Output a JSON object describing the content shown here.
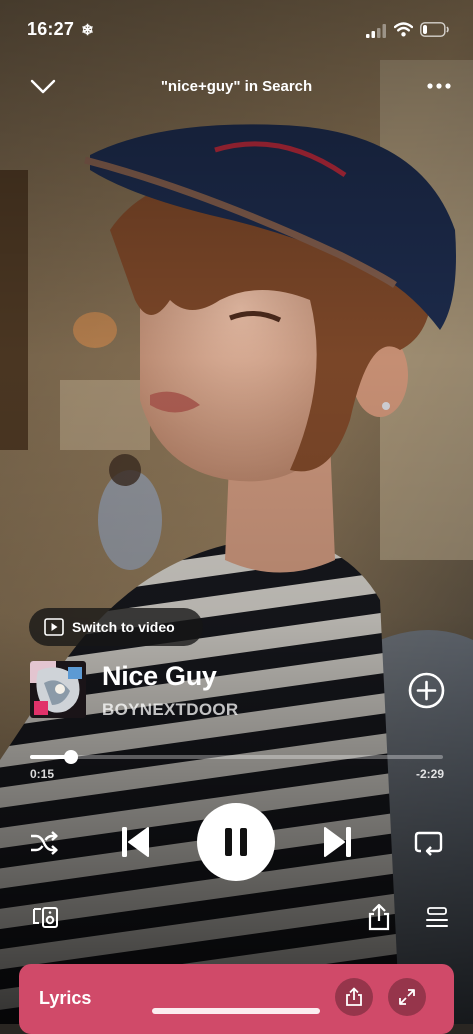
{
  "status_bar": {
    "time": "16:27",
    "snowflake": "❄",
    "icons": [
      "snowflake-icon",
      "cellular-signal-icon",
      "wifi-icon",
      "battery-icon"
    ],
    "battery_level": 0.2
  },
  "header": {
    "title": "\"nice+guy\" in Search",
    "icons": [
      "chevron-down-icon",
      "more-options-icon"
    ]
  },
  "video": {
    "switch_label": "Switch to video"
  },
  "track": {
    "title": "Nice Guy",
    "artist": "BOYNEXTDOOR"
  },
  "progress": {
    "elapsed": "0:15",
    "remaining": "-2:29",
    "fraction": 0.1
  },
  "controls": {
    "icons": [
      "shuffle-icon",
      "previous-track-icon",
      "pause-icon",
      "next-track-icon",
      "repeat-icon"
    ]
  },
  "bottom_actions": {
    "icons": [
      "connect-device-icon",
      "share-icon",
      "queue-icon"
    ]
  },
  "lyrics": {
    "label": "Lyrics",
    "icons": [
      "share-icon",
      "expand-icon"
    ]
  },
  "colors": {
    "lyrics_card": "#d04a69",
    "accent": "#ffffff"
  }
}
